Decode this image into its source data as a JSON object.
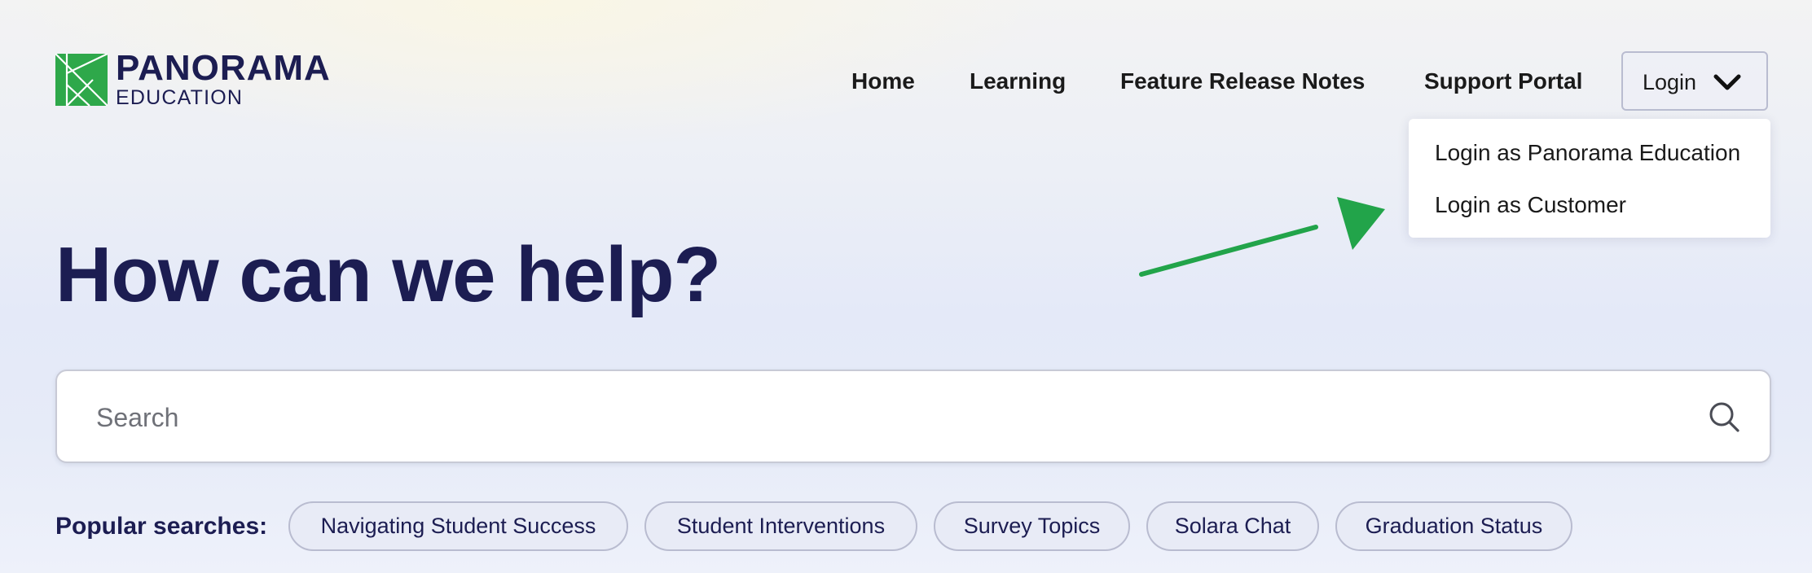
{
  "brand": {
    "name": "PANORAMA",
    "sub": "EDUCATION",
    "color": "#1c1d52",
    "logo_color": "#2ea84a",
    "logo_icon": "tangram-square-icon"
  },
  "nav": {
    "items": [
      {
        "label": "Home"
      },
      {
        "label": "Learning"
      },
      {
        "label": "Feature Release Notes"
      },
      {
        "label": "Support Portal"
      }
    ],
    "login": {
      "label": "Login",
      "icon": "chevron-down-icon",
      "menu": [
        {
          "label": "Login as Panorama Education"
        },
        {
          "label": "Login as Customer"
        }
      ]
    }
  },
  "hero": {
    "title": "How can we help?"
  },
  "search": {
    "placeholder": "Search",
    "value": "",
    "icon": "search-icon"
  },
  "popular": {
    "label": "Popular searches:",
    "chips": [
      {
        "label": "Navigating Student Success"
      },
      {
        "label": "Student Interventions"
      },
      {
        "label": "Survey Topics"
      },
      {
        "label": "Solara Chat"
      },
      {
        "label": "Graduation Status"
      }
    ]
  },
  "annotation": {
    "arrow_color": "#22a44a",
    "icon": "green-arrow-icon"
  }
}
